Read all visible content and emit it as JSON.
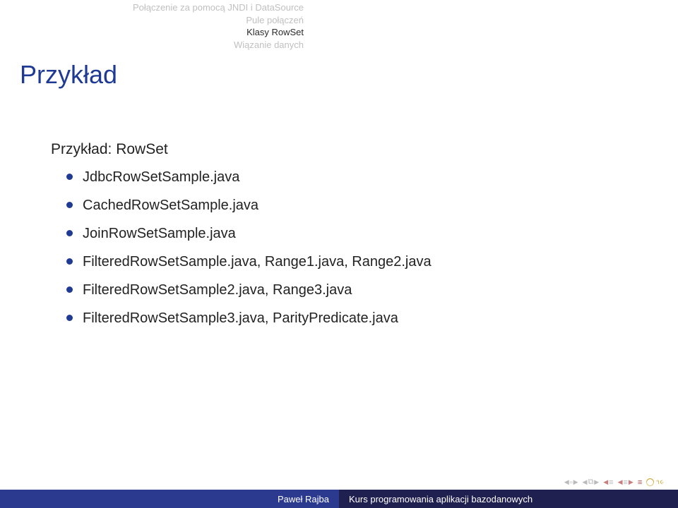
{
  "nav": {
    "items": [
      "Połączenie za pomocą JNDI i DataSource",
      "Pule połączeń",
      "Klasy RowSet",
      "Wiązanie danych"
    ],
    "active_index": 2
  },
  "frametitle": "Przykład",
  "subtitle": "Przykład: RowSet",
  "bullets": [
    "JdbcRowSetSample.java",
    "CachedRowSetSample.java",
    "JoinRowSetSample.java",
    "FilteredRowSetSample.java, Range1.java, Range2.java",
    "FilteredRowSetSample2.java, Range3.java",
    "FilteredRowSetSample3.java, ParityPredicate.java"
  ],
  "footer": {
    "author": "Paweł Rajba",
    "title": "Kurs programowania aplikacji bazodanowych"
  },
  "icons": {
    "left": "◀",
    "right": "▶",
    "square": "▫",
    "bars": "≡"
  }
}
